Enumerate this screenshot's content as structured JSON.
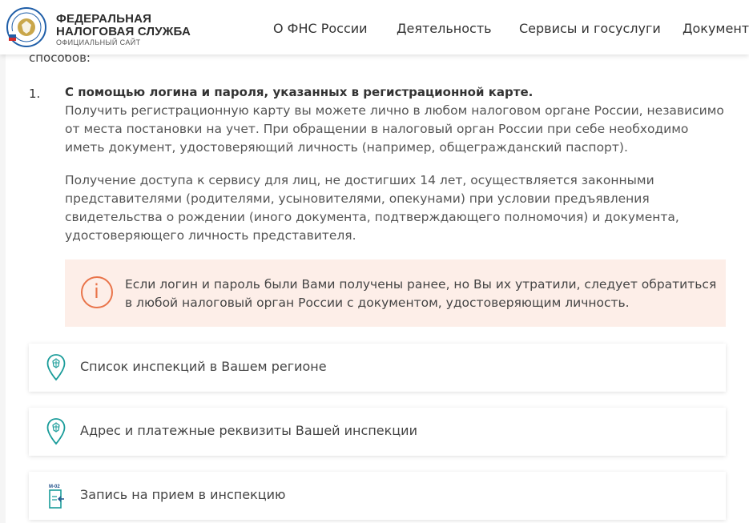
{
  "header": {
    "logo_line1": "ФЕДЕРАЛЬНАЯ",
    "logo_line2": "НАЛОГОВАЯ СЛУЖБА",
    "logo_sub": "ОФИЦИАЛЬНЫЙ САЙТ",
    "nav": [
      "О ФНС России",
      "Деятельность",
      "Сервисы и госуслуги",
      "Документы"
    ]
  },
  "content": {
    "intro_tail": "способов:",
    "item_number": "1.",
    "item_title": "С помощью логина и пароля, указанных в регистрационной карте.",
    "para1": "Получить регистрационную карту вы можете лично в любом налоговом органе России, независимо от места постановки на учет. При обращении в налоговый орган России при себе необходимо иметь документ, удостоверяющий личность (например, общегражданский паспорт).",
    "para2": "Получение доступа к сервису для лиц, не достигших 14 лет, осуществляется законными представителями (родителями, усыновителями, опекунами) при условии предъявления свидетельства о рождении (иного документа, подтверждающего полномочия) и документа, удостоверяющего личность представителя.",
    "notice_icon": "i",
    "notice_text": "Если логин и пароль были Вами получены ранее, но Вы их утратили, следует обратиться в любой налоговый орган России с документом, удостоверяющим личность."
  },
  "cards": [
    {
      "label": "Список инспекций в Вашем регионе",
      "icon": "map-pin-icon"
    },
    {
      "label": "Адрес и платежные реквизиты Вашей инспекции",
      "icon": "map-pin-icon"
    },
    {
      "label": "Запись на прием в инспекцию",
      "icon": "appointment-icon",
      "icon_text": "М-02"
    }
  ],
  "colors": {
    "accent_teal": "#1a9c9a",
    "notice_bg": "#fdeee8",
    "notice_icon": "#e9744a"
  }
}
